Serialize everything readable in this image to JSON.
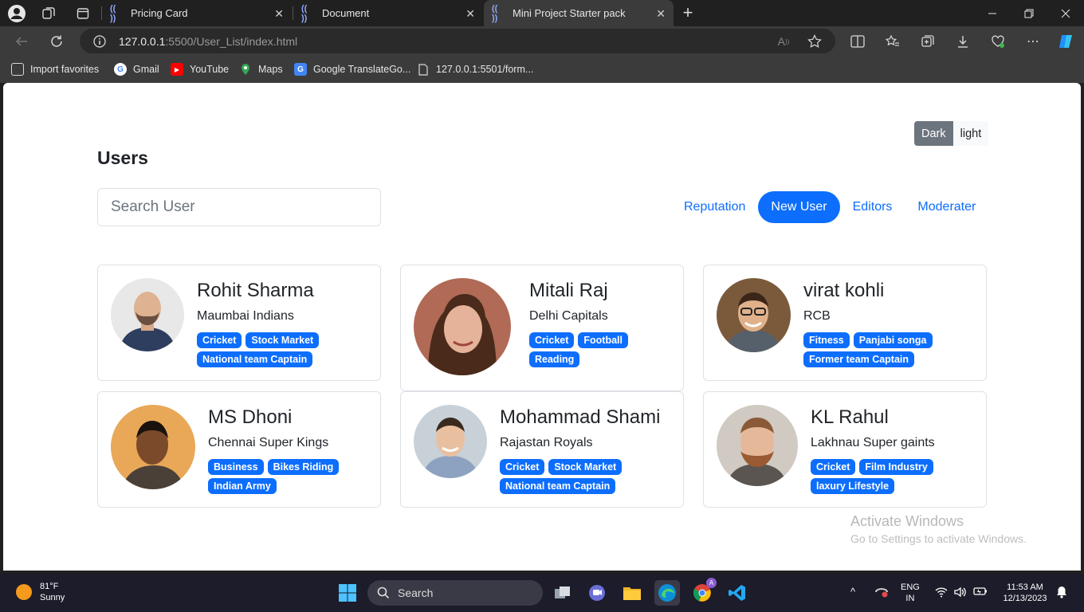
{
  "browser": {
    "tabs": [
      {
        "title": "Pricing Card",
        "active": false
      },
      {
        "title": "Document",
        "active": false
      },
      {
        "title": "Mini Project Starter pack",
        "active": true
      }
    ],
    "address": {
      "host": "127.0.0.1",
      "rest": ":5500/User_List/index.html"
    },
    "favorites": [
      {
        "label": "Import favorites",
        "icon": "import-icon"
      },
      {
        "label": "Gmail",
        "icon": "google-icon"
      },
      {
        "label": "YouTube",
        "icon": "youtube-icon"
      },
      {
        "label": "Maps",
        "icon": "maps-pin-icon"
      },
      {
        "label": "Google TranslateGo...",
        "icon": "translate-icon"
      },
      {
        "label": "127.0.0.1:5501/form...",
        "icon": "page-icon"
      }
    ]
  },
  "page": {
    "title": "Users",
    "theme_toggle": {
      "dark": "Dark",
      "light": "light"
    },
    "search": {
      "placeholder": "Search User",
      "value": ""
    },
    "filters": [
      {
        "label": "Reputation",
        "active": false
      },
      {
        "label": "New User",
        "active": true
      },
      {
        "label": "Editors",
        "active": false
      },
      {
        "label": "Moderater",
        "active": false
      }
    ],
    "users": [
      {
        "name": "Rohit Sharma",
        "team": "Maumbai Indians",
        "tags": [
          "Cricket",
          "Stock Market",
          "National team Captain"
        ]
      },
      {
        "name": "Mitali Raj",
        "team": "Delhi Capitals",
        "tags": [
          "Cricket",
          "Football",
          "Reading"
        ]
      },
      {
        "name": "virat kohli",
        "team": "RCB",
        "tags": [
          "Fitness",
          "Panjabi songa",
          "Former team Captain"
        ]
      },
      {
        "name": "MS Dhoni",
        "team": "Chennai Super Kings",
        "tags": [
          "Business",
          "Bikes Riding",
          "Indian Army"
        ]
      },
      {
        "name": "Mohammad Shami",
        "team": "Rajastan Royals",
        "tags": [
          "Cricket",
          "Stock Market",
          "National team Captain"
        ]
      },
      {
        "name": "KL Rahul",
        "team": "Lakhnau Super gaints",
        "tags": [
          "Cricket",
          "Film Industry",
          "laxury Lifestyle"
        ]
      }
    ],
    "watermark": {
      "title": "Activate Windows",
      "subtitle": "Go to Settings to activate Windows."
    }
  },
  "taskbar": {
    "weather": {
      "temp": "81°F",
      "condition": "Sunny"
    },
    "search_label": "Search",
    "lang": {
      "line1": "ENG",
      "line2": "IN"
    },
    "clock": {
      "time": "11:53 AM",
      "date": "12/13/2023"
    },
    "profile_badge": "A"
  },
  "colors": {
    "primary": "#0d6efd",
    "dark_btn": "#6c757d",
    "chrome_bg": "#202020",
    "toolbar_bg": "#3b3b3b"
  }
}
